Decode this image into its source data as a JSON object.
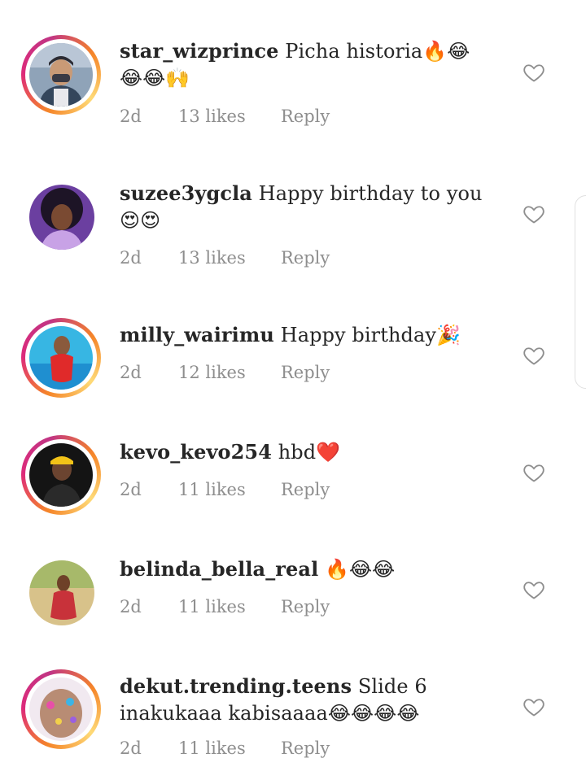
{
  "comments": [
    {
      "username": "star_wizprince",
      "text_line1": "Picha historia",
      "line1_emoji": "🔥😂",
      "text_line2": "",
      "line2_emoji": "😂😂🙌",
      "time": "2d",
      "likes": "13 likes",
      "reply": "Reply",
      "story_ring": true,
      "avatar": "avatar-man-cap"
    },
    {
      "username": "suzee3ygcla",
      "text_line1": "Happy birthday to you",
      "line1_emoji": "",
      "text_line2": "",
      "line2_emoji": "😍😍",
      "time": "2d",
      "likes": "13 likes",
      "reply": "Reply",
      "story_ring": false,
      "avatar": "avatar-cartoon-woman"
    },
    {
      "username": "milly_wairimu",
      "text_line1": "Happy birthday",
      "line1_emoji": "🎉",
      "text_line2": "",
      "line2_emoji": "",
      "time": "2d",
      "likes": "12 likes",
      "reply": "Reply",
      "story_ring": true,
      "avatar": "avatar-woman-pool"
    },
    {
      "username": "kevo_kevo254",
      "text_line1": "hbd",
      "line1_emoji": "❤️",
      "text_line2": "",
      "line2_emoji": "",
      "time": "2d",
      "likes": "11 likes",
      "reply": "Reply",
      "story_ring": true,
      "avatar": "avatar-man-yellow-cap"
    },
    {
      "username": "belinda_bella_real",
      "text_line1": "",
      "line1_emoji": "🔥😂😂",
      "text_line2": "",
      "line2_emoji": "",
      "time": "2d",
      "likes": "11 likes",
      "reply": "Reply",
      "story_ring": false,
      "avatar": "avatar-woman-red-dress"
    },
    {
      "username": "dekut.trending.teens",
      "text_line1": "Slide 6",
      "line1_emoji": "",
      "text_line2": "inakukaaa kabisaaaa",
      "line2_emoji": "😂😂😂😂",
      "time": "2d",
      "likes": "11 likes",
      "reply": "Reply",
      "story_ring": true,
      "avatar": "avatar-face-stickers"
    }
  ],
  "icons": {
    "like": "heart-outline-icon"
  },
  "colors": {
    "text": "#262626",
    "meta": "#8e8e8e",
    "ring_start": "#f58529",
    "ring_end": "#dd2a7b"
  }
}
